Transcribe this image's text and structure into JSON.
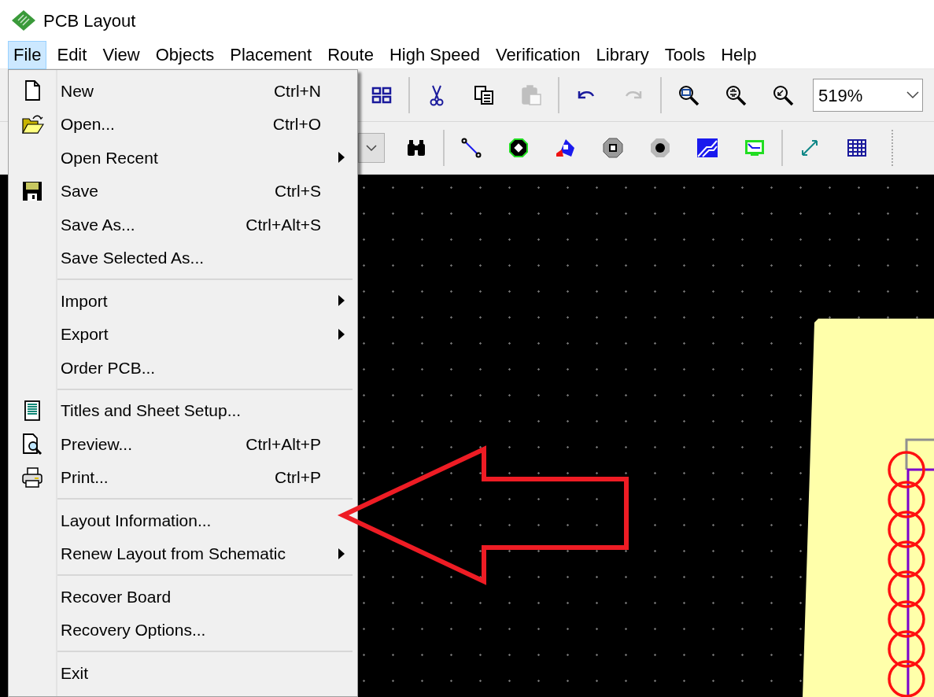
{
  "window": {
    "title": "PCB Layout"
  },
  "menu_bar": [
    {
      "label": "File",
      "selected": true
    },
    {
      "label": "Edit",
      "selected": false
    },
    {
      "label": "View",
      "selected": false
    },
    {
      "label": "Objects",
      "selected": false
    },
    {
      "label": "Placement",
      "selected": false
    },
    {
      "label": "Route",
      "selected": false
    },
    {
      "label": "High Speed",
      "selected": false
    },
    {
      "label": "Verification",
      "selected": false
    },
    {
      "label": "Library",
      "selected": false
    },
    {
      "label": "Tools",
      "selected": false
    },
    {
      "label": "Help",
      "selected": false
    }
  ],
  "file_menu": [
    {
      "kind": "item",
      "label": "New",
      "shortcut": "Ctrl+N",
      "submenu": false
    },
    {
      "kind": "item",
      "label": "Open...",
      "shortcut": "Ctrl+O",
      "submenu": false
    },
    {
      "kind": "item",
      "label": "Open Recent",
      "submenu": true
    },
    {
      "kind": "item",
      "label": "Save",
      "shortcut": "Ctrl+S",
      "submenu": false
    },
    {
      "kind": "item",
      "label": "Save As...",
      "shortcut": "Ctrl+Alt+S",
      "submenu": false
    },
    {
      "kind": "item",
      "label": "Save Selected As...",
      "submenu": false
    },
    {
      "kind": "separator"
    },
    {
      "kind": "item",
      "label": "Import",
      "submenu": true
    },
    {
      "kind": "item",
      "label": "Export",
      "submenu": true
    },
    {
      "kind": "item",
      "label": "Order PCB...",
      "submenu": false
    },
    {
      "kind": "separator"
    },
    {
      "kind": "item",
      "label": "Titles and Sheet Setup...",
      "submenu": false
    },
    {
      "kind": "item",
      "label": "Preview...",
      "shortcut": "Ctrl+Alt+P",
      "submenu": false
    },
    {
      "kind": "item",
      "label": "Print...",
      "shortcut": "Ctrl+P",
      "submenu": false
    },
    {
      "kind": "separator"
    },
    {
      "kind": "item",
      "label": "Layout Information...",
      "submenu": false
    },
    {
      "kind": "item",
      "label": "Renew Layout from Schematic",
      "submenu": true
    },
    {
      "kind": "separator"
    },
    {
      "kind": "item",
      "label": "Recover Board",
      "submenu": false
    },
    {
      "kind": "item",
      "label": "Recovery Options...",
      "submenu": false
    },
    {
      "kind": "separator"
    },
    {
      "kind": "item",
      "label": "Exit",
      "submenu": false
    }
  ],
  "toolbar_1": {
    "groups": [
      [
        {
          "disabled": false
        }
      ],
      [
        {
          "disabled": false
        },
        {
          "disabled": false
        },
        {
          "disabled": true
        }
      ],
      [
        {
          "disabled": false
        },
        {
          "disabled": true
        }
      ],
      [
        {
          "disabled": false
        },
        {
          "disabled": false
        },
        {
          "disabled": false
        }
      ]
    ],
    "zoom": "519%"
  },
  "toolbar_2": {
    "groups": [
      [
        {
          "disabled": false
        }
      ],
      [
        {
          "disabled": false
        },
        {
          "disabled": false
        },
        {
          "disabled": false
        },
        {
          "disabled": false
        },
        {
          "disabled": false
        },
        {
          "disabled": false
        },
        {
          "disabled": false
        }
      ],
      [
        {
          "disabled": false
        },
        {
          "disabled": false
        }
      ]
    ]
  }
}
